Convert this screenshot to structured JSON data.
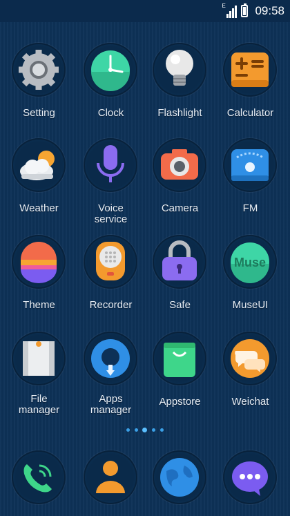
{
  "status_bar": {
    "network": "E",
    "time": "09:58",
    "battery_level": 0.85
  },
  "apps": [
    {
      "name": "setting",
      "label": "Setting",
      "icon": "gear-icon"
    },
    {
      "name": "clock",
      "label": "Clock",
      "icon": "clock-icon"
    },
    {
      "name": "flashlight",
      "label": "Flashlight",
      "icon": "bulb-icon"
    },
    {
      "name": "calculator",
      "label": "Calculator",
      "icon": "calculator-icon"
    },
    {
      "name": "weather",
      "label": "Weather",
      "icon": "cloud-sun-icon"
    },
    {
      "name": "voice-service",
      "label": "Voice\nservice",
      "icon": "microphone-icon"
    },
    {
      "name": "camera",
      "label": "Camera",
      "icon": "camera-icon"
    },
    {
      "name": "fm",
      "label": "FM",
      "icon": "radio-icon"
    },
    {
      "name": "theme",
      "label": "Theme",
      "icon": "theme-icon"
    },
    {
      "name": "recorder",
      "label": "Recorder",
      "icon": "recorder-icon"
    },
    {
      "name": "safe",
      "label": "Safe",
      "icon": "lock-icon"
    },
    {
      "name": "museui",
      "label": "MuseUI",
      "icon": "muse-icon",
      "icon_text": "Muse"
    },
    {
      "name": "file-manager",
      "label": "File\nmanager",
      "icon": "folder-icon"
    },
    {
      "name": "apps-manager",
      "label": "Apps\nmanager",
      "icon": "download-icon"
    },
    {
      "name": "appstore",
      "label": "Appstore",
      "icon": "shopping-bag-icon"
    },
    {
      "name": "weichat",
      "label": "Weichat",
      "icon": "chat-icon"
    }
  ],
  "page_indicator": {
    "pages": 5,
    "current": 3
  },
  "dock": [
    {
      "name": "phone",
      "icon": "phone-icon"
    },
    {
      "name": "contacts",
      "icon": "contact-icon"
    },
    {
      "name": "browser",
      "icon": "globe-icon"
    },
    {
      "name": "messages",
      "icon": "message-icon"
    }
  ],
  "colors": {
    "background": "#0d3157",
    "label": "#e8eef5",
    "indicator": "#3ba0e6"
  }
}
